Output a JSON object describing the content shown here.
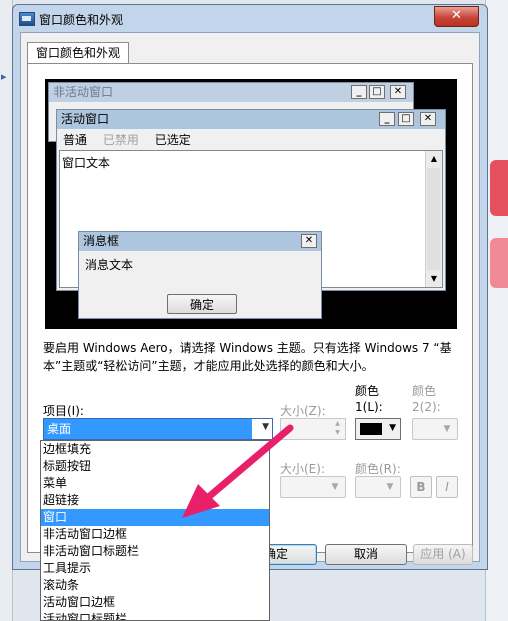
{
  "window": {
    "title": "窗口颜色和外观",
    "close_label": "✕"
  },
  "tab": {
    "label": "窗口颜色和外观"
  },
  "preview": {
    "inactive_title": "非活动窗口",
    "active_title": "活动窗口",
    "menu": {
      "normal": "普通",
      "disabled": "已禁用",
      "selected": "已选定"
    },
    "window_text": "窗口文本",
    "msgbox_title": "消息框",
    "msgbox_text": "消息文本",
    "ok_label": "确定",
    "min_glyph": "_",
    "max_glyph": "□",
    "close_glyph": "✕"
  },
  "notice": "要启用 Windows Aero，请选择 Windows 主题。只有选择 Windows 7 “基本”主题或“轻松访问”主题，才能应用此处选择的颜色和大小。",
  "labels": {
    "item": "项目(I):",
    "size_z": "大小(Z):",
    "color1_top": "颜色",
    "color1": "1(L):",
    "color2_top": "颜色",
    "color2": "2(2):",
    "size_e": "大小(E):",
    "color_r": "颜色(R):",
    "bold": "B",
    "italic": "I"
  },
  "item_combo": {
    "value": "桌面"
  },
  "dropdown": {
    "options": [
      "边框填充",
      "标题按钮",
      "菜单",
      "超链接",
      "窗口",
      "非活动窗口边框",
      "非活动窗口标题栏",
      "工具提示",
      "滚动条",
      "活动窗口边框",
      "活动窗口标题栏"
    ],
    "selected_index": 4
  },
  "buttons": {
    "ok": "确定",
    "cancel": "取消",
    "apply": "应用 (A)"
  },
  "colors": {
    "accent": "#3399ff",
    "annotation": "#e8206a"
  }
}
